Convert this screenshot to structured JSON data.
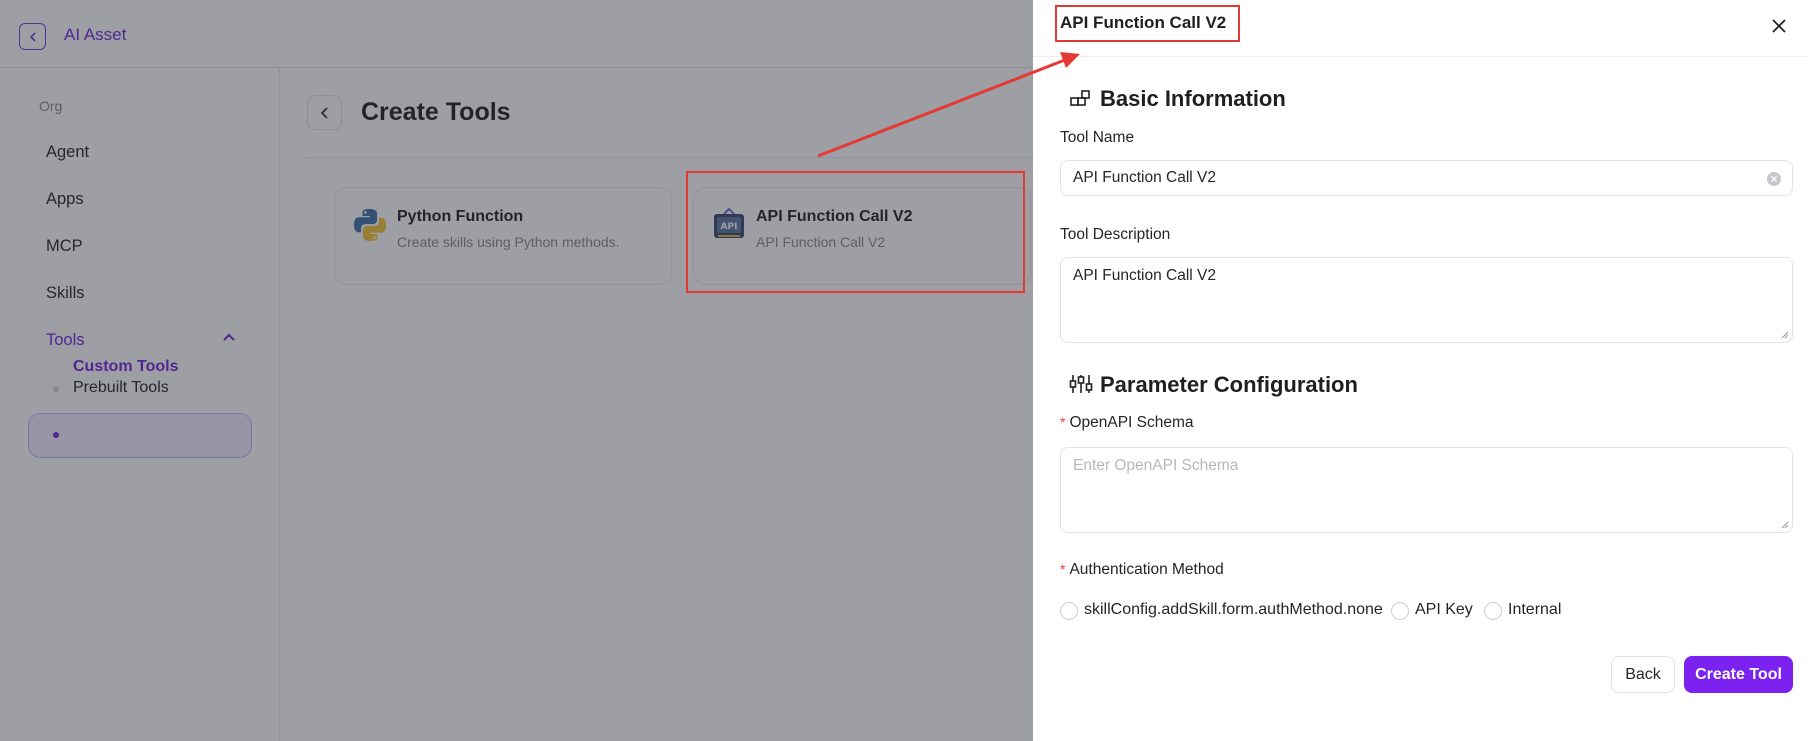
{
  "header": {
    "app_title": "AI Asset"
  },
  "sidebar": {
    "org_label": "Org",
    "items": [
      {
        "label": "Agent"
      },
      {
        "label": "Apps"
      },
      {
        "label": "MCP"
      },
      {
        "label": "Skills"
      },
      {
        "label": "Tools"
      }
    ],
    "sub_items": [
      {
        "label": "Prebuilt Tools"
      },
      {
        "label": "Custom Tools"
      }
    ]
  },
  "main": {
    "title": "Create Tools",
    "cards": [
      {
        "title": "Python Function",
        "description": "Create skills using Python methods.",
        "icon": "python-icon"
      },
      {
        "title": "API Function Call V2",
        "description": "API Function Call V2",
        "icon": "api-icon"
      }
    ]
  },
  "drawer": {
    "title": "API Function Call V2",
    "basic_section": "Basic Information",
    "tool_name_label": "Tool Name",
    "tool_name_value": "API Function Call V2",
    "tool_desc_label": "Tool Description",
    "tool_desc_value": "API Function Call V2",
    "param_section": "Parameter Configuration",
    "schema_label": "OpenAPI Schema",
    "schema_placeholder": "Enter OpenAPI Schema",
    "auth_label": "Authentication Method",
    "auth_options": [
      "skillConfig.addSkill.form.authMethod.none",
      "API Key",
      "Internal"
    ],
    "back_label": "Back",
    "create_label": "Create Tool",
    "required_mark": "*"
  },
  "colors": {
    "accent": "#7c22f0",
    "accent_text": "#6d28d9",
    "annotation_red": "#e53935"
  }
}
